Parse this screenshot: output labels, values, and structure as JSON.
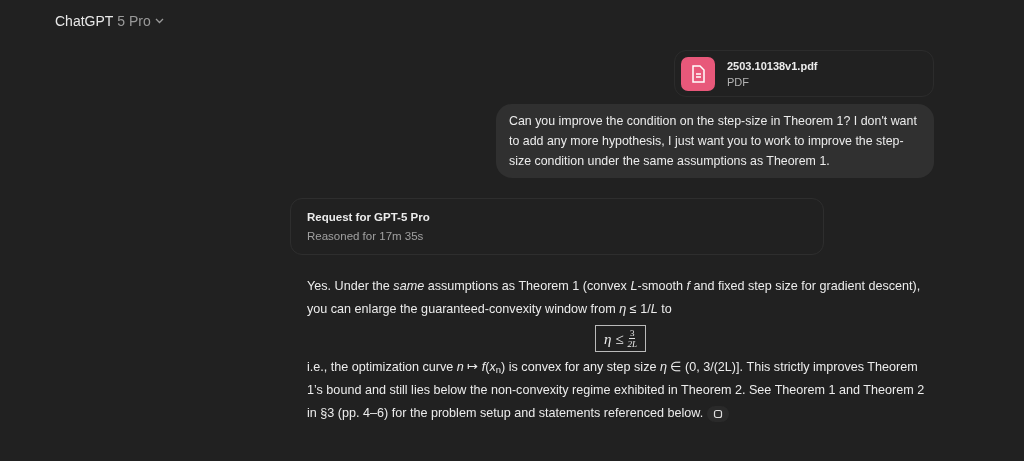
{
  "header": {
    "model": "ChatGPT",
    "variant": "5 Pro"
  },
  "attachment": {
    "filename": "2503.10138v1.pdf",
    "filetype": "PDF"
  },
  "user_message": "Can you improve the condition on the step-size in Theorem 1? I don't want to add any more hypothesis, I just want you to work to improve the step-size condition under the same assumptions as Theorem 1.",
  "reasoning": {
    "title": "Request for GPT-5 Pro",
    "duration": "Reasoned for 17m 35s"
  },
  "answer": {
    "intro": "Yes. Under the *same* assumptions as Theorem 1 (convex *L*-smooth *f* and fixed step size for gradient descent), you can enlarge the guaranteed-convexity window from *η* ≤ 1/*L* to",
    "formula": {
      "lhs": "η ≤",
      "numerator": "3",
      "denominator": "2L"
    },
    "body": "i.e., the optimization curve *n* ↦ *f*(*x*$_{n}$) is convex for any step size *η* ∈ (0, 3/(2L)]. This strictly improves Theorem 1’s bound and still lies below the non-convexity regime exhibited in Theorem 2. See Theorem 1 and Theorem 2 in §3 (pp. 4–6) for the problem setup and statements referenced below."
  }
}
